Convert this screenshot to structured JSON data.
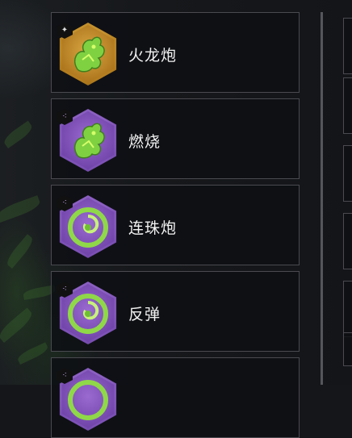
{
  "skills": [
    {
      "name": "火龙炮",
      "rarity": "gold",
      "badge_icon": "cross-diamond-icon",
      "art": "dragon-icon"
    },
    {
      "name": "燃烧",
      "rarity": "purple",
      "badge_icon": "triple-dot-icon",
      "art": "dragon-icon"
    },
    {
      "name": "连珠炮",
      "rarity": "purple",
      "badge_icon": "triple-dot-icon",
      "art": "swirl-icon"
    },
    {
      "name": "反弹",
      "rarity": "purple",
      "badge_icon": "triple-dot-icon",
      "art": "swirl-icon"
    },
    {
      "name": "",
      "rarity": "purple",
      "badge_icon": "triple-dot-icon",
      "art": "swirl-icon"
    }
  ],
  "colors": {
    "gold": "#c08a25",
    "purple": "#7d52b6",
    "text": "#f2f2f2",
    "border": "#4a4a50"
  }
}
